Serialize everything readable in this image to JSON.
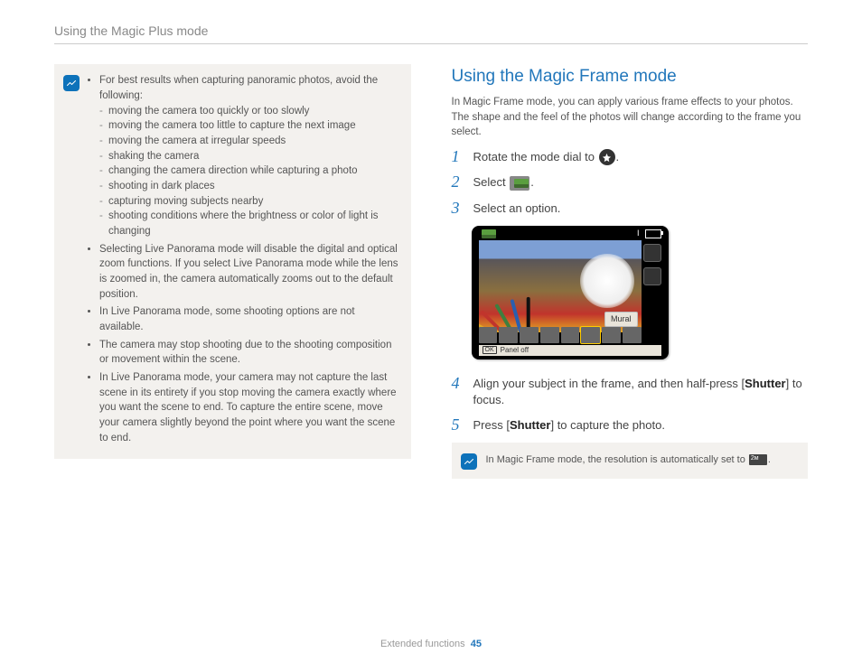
{
  "header": {
    "title": "Using the Magic Plus mode"
  },
  "left_note": {
    "intro": "For best results when capturing panoramic photos, avoid the following:",
    "sub": [
      "moving the camera too quickly or too slowly",
      "moving the camera too little to capture the next image",
      "moving the camera at irregular speeds",
      "shaking the camera",
      "changing the camera direction while capturing a photo",
      "shooting in dark places",
      "capturing moving subjects nearby",
      "shooting conditions where the brightness or color of light is changing"
    ],
    "bullets": [
      "Selecting Live Panorama mode will disable the digital and optical zoom functions. If you select Live Panorama mode while the lens is zoomed in, the camera automatically zooms out to the default position.",
      "In Live Panorama mode, some shooting options are not available.",
      "The camera may stop shooting due to the shooting composition or movement within the scene.",
      "In Live Panorama mode, your camera may not capture the last scene in its entirety if you stop moving the camera exactly where you want the scene to end. To capture the entire scene, move your camera slightly beyond the point where you want the scene to end."
    ]
  },
  "right": {
    "title": "Using the Magic Frame mode",
    "intro": "In Magic Frame mode, you can apply various frame effects to your photos. The shape and the feel of the photos will change according to the frame you select.",
    "step1_pre": "Rotate the mode dial to ",
    "step1_post": ".",
    "step2_pre": "Select ",
    "step2_post": ".",
    "step3": "Select an option.",
    "mural_label": "Mural",
    "panel_off": "Panel off",
    "ok": "OK",
    "step4_a": "Align your subject in the frame, and then half-press [",
    "step4_b": "Shutter",
    "step4_c": "] to focus.",
    "step5_a": "Press [",
    "step5_b": "Shutter",
    "step5_c": "] to capture the photo.",
    "note2_a": "In Magic Frame mode, the resolution is automatically set to ",
    "note2_b": "."
  },
  "footer": {
    "section": "Extended functions",
    "page": "45"
  }
}
